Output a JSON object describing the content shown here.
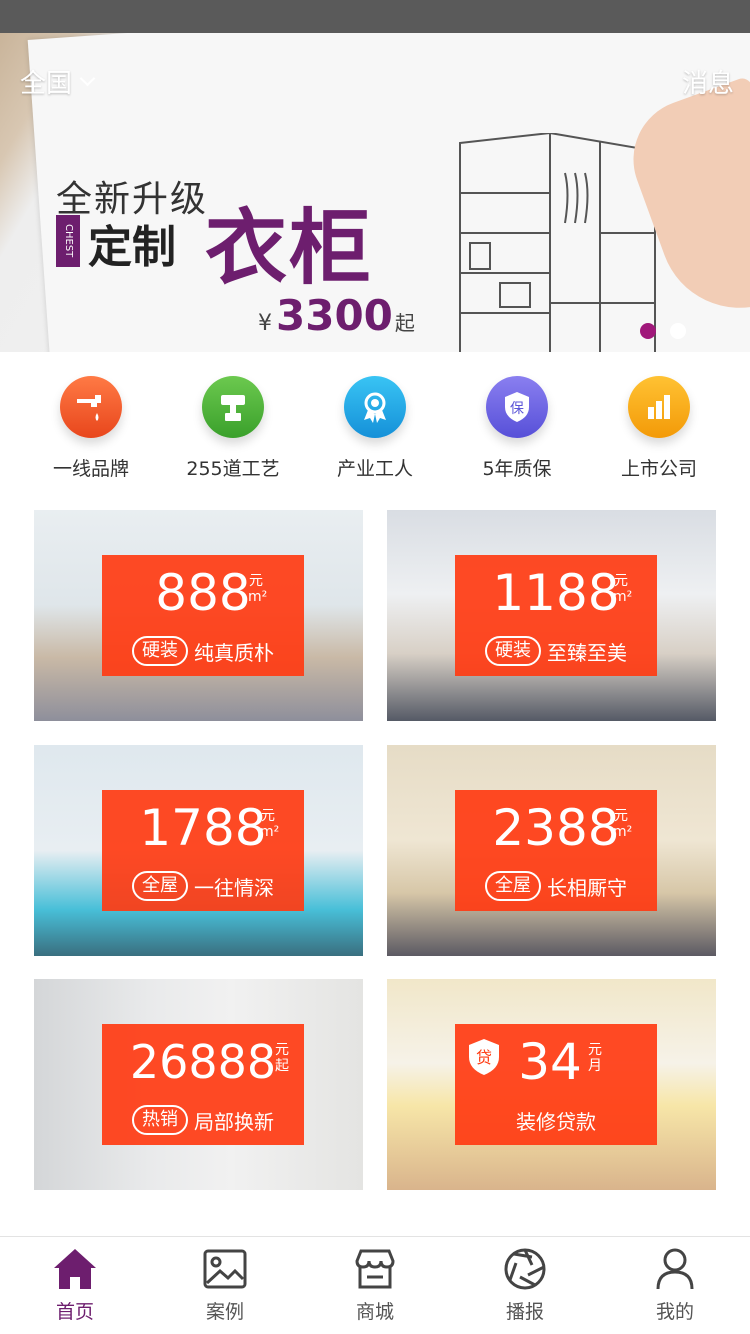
{
  "header": {
    "region": "全国",
    "messages": "消息"
  },
  "banner": {
    "line1": "全新升级",
    "badge": "CHEST",
    "line2": "定制",
    "headline": "衣柜",
    "currency": "¥",
    "price": "3300",
    "price_suffix": "起",
    "slides_total": 2,
    "slide_active": 1
  },
  "features": [
    {
      "label": "一线品牌",
      "icon": "faucet-icon",
      "color": "#f35a2a"
    },
    {
      "label": "255道工艺",
      "icon": "brush-icon",
      "color": "#4db33d"
    },
    {
      "label": "产业工人",
      "icon": "award-icon",
      "color": "#1aa8e8"
    },
    {
      "label": "5年质保",
      "icon": "shield-icon",
      "icon_text": "保",
      "color": "#6b63e8"
    },
    {
      "label": "上市公司",
      "icon": "bar-chart-icon",
      "color": "#f7a410"
    }
  ],
  "packages": [
    {
      "price": "888",
      "unit_top": "元",
      "unit_bottom": "m²",
      "pill": "硬装",
      "title": "纯真质朴"
    },
    {
      "price": "1188",
      "unit_top": "元",
      "unit_bottom": "m²",
      "pill": "硬装",
      "title": "至臻至美"
    },
    {
      "price": "1788",
      "unit_top": "元",
      "unit_bottom": "m²",
      "pill": "全屋",
      "title": "一往情深"
    },
    {
      "price": "2388",
      "unit_top": "元",
      "unit_bottom": "m²",
      "pill": "全屋",
      "title": "长相厮守"
    },
    {
      "price": "26888",
      "unit_top": "元",
      "unit_bottom": "起",
      "pill": "热销",
      "title": "局部换新"
    },
    {
      "price": "34",
      "unit_top": "元",
      "unit_bottom": "月",
      "badge": "贷",
      "title": "装修贷款"
    }
  ],
  "tabbar": [
    {
      "label": "首页",
      "icon": "home-icon",
      "active": true
    },
    {
      "label": "案例",
      "icon": "image-icon"
    },
    {
      "label": "商城",
      "icon": "store-icon"
    },
    {
      "label": "播报",
      "icon": "aperture-icon"
    },
    {
      "label": "我的",
      "icon": "user-icon"
    }
  ],
  "colors": {
    "brand": "#6d1e6e",
    "tag": "#ff3b12",
    "dot_active": "#a0187a"
  }
}
